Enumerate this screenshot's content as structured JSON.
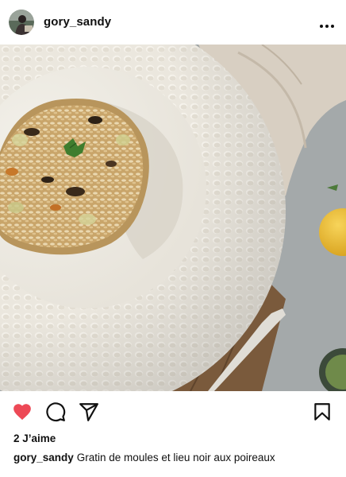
{
  "post": {
    "username": "gory_sandy",
    "likes_text": "2 J’aime",
    "caption_user": "gory_sandy",
    "caption_text": "Gratin de moules et lieu noir aux poireaux",
    "liked": true
  },
  "icons": {
    "more": "more-options-icon",
    "like": "heart-icon",
    "comment": "comment-icon",
    "share": "paper-plane-icon",
    "save": "bookmark-icon"
  },
  "colors": {
    "like": "#ed4956",
    "text": "#111111"
  }
}
